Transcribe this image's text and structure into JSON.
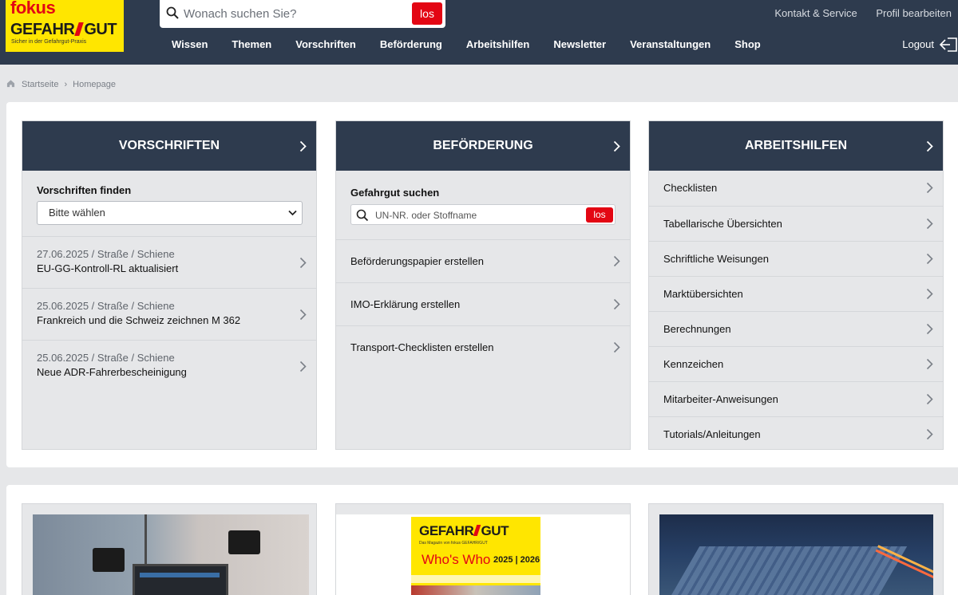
{
  "header": {
    "logo": {
      "line1": "fokus",
      "line2a": "GEFAHR",
      "line2b": "GUT",
      "tagline": "Sicher in der Gefahrgut-Praxis"
    },
    "search": {
      "placeholder": "Wonach suchen Sie?",
      "button": "los"
    },
    "top_links": [
      "Kontakt & Service",
      "Profil bearbeiten"
    ],
    "nav": [
      "Wissen",
      "Themen",
      "Vorschriften",
      "Beförderung",
      "Arbeitshilfen",
      "Newsletter",
      "Veranstaltungen",
      "Shop"
    ],
    "logout": "Logout"
  },
  "breadcrumb": [
    "Startseite",
    "Homepage"
  ],
  "vorschriften": {
    "title": "VORSCHRIFTEN",
    "finder_label": "Vorschriften finden",
    "select_value": "Bitte wählen",
    "news": [
      {
        "date": "27.06.2025 / Straße / Schiene",
        "title": "EU-GG-Kontroll-RL aktualisiert"
      },
      {
        "date": "25.06.2025 / Straße / Schiene",
        "title": "Frankreich und die Schweiz zeichnen M 362"
      },
      {
        "date": "25.06.2025 / Straße / Schiene",
        "title": "Neue ADR-Fahrerbescheinigung"
      }
    ]
  },
  "befoerderung": {
    "title": "BEFÖRDERUNG",
    "search_label": "Gefahrgut suchen",
    "search_placeholder": "UN-NR. oder Stoffname",
    "search_button": "los",
    "items": [
      "Beförderungspapier erstellen",
      "IMO-Erklärung erstellen",
      "Transport-Checklisten erstellen"
    ]
  },
  "arbeitshilfen": {
    "title": "ARBEITSHILFEN",
    "items": [
      "Checklisten",
      "Tabellarische Übersichten",
      "Schriftliche Weisungen",
      "Marktübersichten",
      "Berechnungen",
      "Kennzeichen",
      "Mitarbeiter-Anweisungen",
      "Tutorials/Anleitungen"
    ]
  },
  "magazine": {
    "title_a": "GEFAHR",
    "title_b": "GUT",
    "subtitle": "Das Magazin von fokus GEFAHR/GUT",
    "headline": "Who's Who",
    "years": "2025 | 2026"
  },
  "colors": {
    "navy": "#2e3b4e",
    "accent_red": "#e30613",
    "brand_yellow": "#ffe600"
  }
}
